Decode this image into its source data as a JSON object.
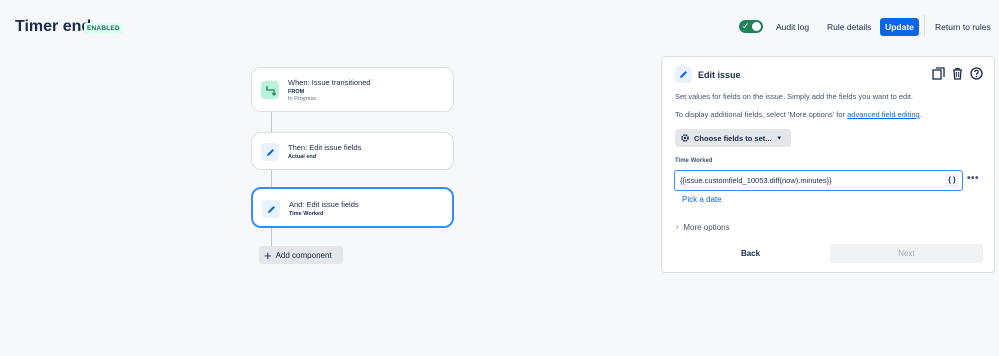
{
  "header": {
    "title": "Timer end",
    "status_badge": "ENABLED",
    "toggle_enabled": true,
    "audit_log": "Audit log",
    "rule_details": "Rule details",
    "update": "Update",
    "return_to_rules": "Return to rules"
  },
  "flow": {
    "nodes": [
      {
        "title": "When: Issue transitioned",
        "line1": "FROM",
        "line2": "In Progress",
        "icon": "transition-arrow-icon"
      },
      {
        "title": "Then: Edit issue fields",
        "line1": "Actual end",
        "icon": "pencil-icon"
      },
      {
        "title": "And: Edit issue fields",
        "line1": "Time Worked",
        "icon": "pencil-icon",
        "selected": true
      }
    ],
    "add_component": "Add component"
  },
  "panel": {
    "title": "Edit issue",
    "description": "Set values for fields on the issue. Simply add the fields you want to edit.",
    "hint_prefix": "To display additional fields, select 'More options' for",
    "hint_link": "advanced field editing",
    "hint_suffix": ".",
    "choose_fields": "Choose fields to set...",
    "field_label": "Time Worked",
    "field_value": "{{issue.customfield_10053.diff(now).minutes}}",
    "brace_label": "{ }",
    "more_dots": "•••",
    "pick_date": "Pick a date",
    "more_options": "More options",
    "back": "Back",
    "next": "Next"
  },
  "colors": {
    "primary": "#0c66e4",
    "enabled_green": "#1f845a",
    "selected_border": "#388bff"
  }
}
